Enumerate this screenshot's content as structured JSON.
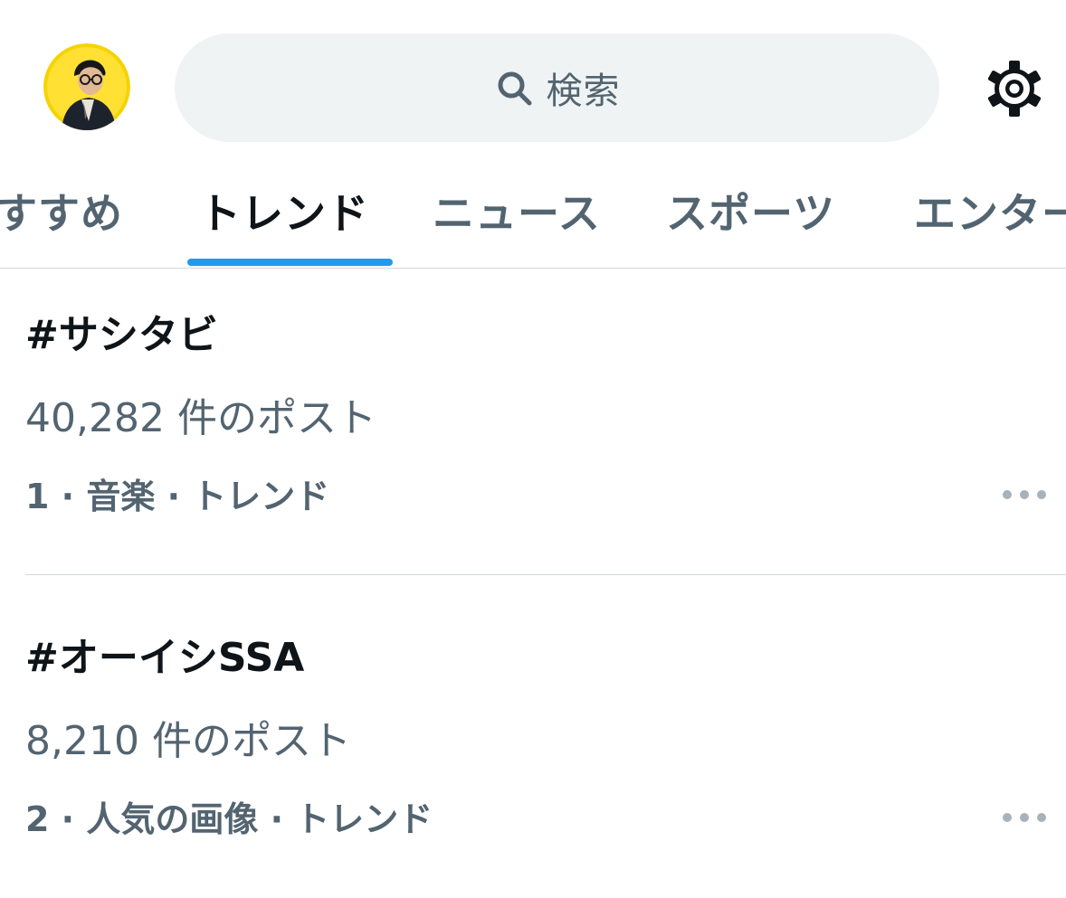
{
  "header": {
    "search_placeholder": "検索",
    "icons": {
      "avatar": "user-avatar",
      "search": "search-icon",
      "settings": "gear-icon"
    }
  },
  "tabs": [
    {
      "label": "おすすめ",
      "active": false
    },
    {
      "label": "トレンド",
      "active": true
    },
    {
      "label": "ニュース",
      "active": false
    },
    {
      "label": "スポーツ",
      "active": false
    },
    {
      "label": "エンターテイメント",
      "active": false
    }
  ],
  "trends": [
    {
      "tag": "#サシタビ",
      "count": "40,282 件のポスト",
      "meta": "1 · 音楽 · トレンド"
    },
    {
      "tag": "#オーイシSSA",
      "count": "8,210 件のポスト",
      "meta": "2 · 人気の画像 · トレンド"
    }
  ],
  "colors": {
    "accent": "#1d9bf0",
    "text_primary": "#0f1419",
    "text_secondary": "#536471",
    "search_bg": "#eff3f4",
    "divider": "#cfd9de",
    "avatar_bg": "#f5d300"
  }
}
